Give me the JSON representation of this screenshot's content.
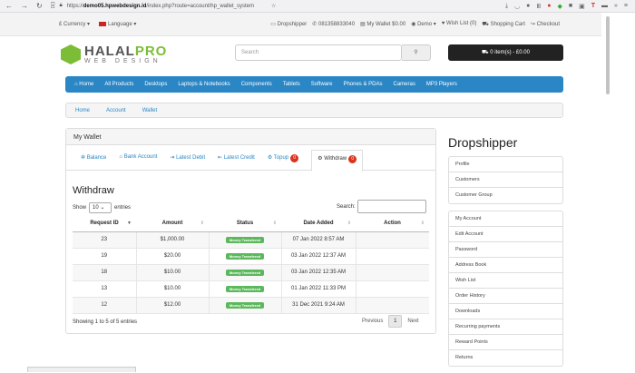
{
  "browser": {
    "url_prefix": "https://",
    "url_host": "demo05.hpwebdesign.id",
    "url_path": "/index.php?route=account/hp_wallet_system"
  },
  "topbar": {
    "currency": "£ Currency ▾",
    "language": "Language ▾",
    "dropshipper": "Dropshipper",
    "phone": "081358833040",
    "wallet": "My Wallet $0.00",
    "demo": "Demo ▾",
    "wishlist": "Wish List (0)",
    "shopping_cart": "Shopping Cart",
    "checkout": "Checkout"
  },
  "logo": {
    "halal": "HALAL",
    "pro": "PRO",
    "sub": "WEB DESIGN"
  },
  "search": {
    "placeholder": "Search"
  },
  "cart": {
    "label": "0 item(s) - £0.00"
  },
  "menu": [
    "Home",
    "All Products",
    "Desktops",
    "Laptops & Notebooks",
    "Components",
    "Tablets",
    "Software",
    "Phones & PDAs",
    "Cameras",
    "MP3 Players"
  ],
  "breadcrumb": [
    "Home",
    "Account",
    "Wallet"
  ],
  "panel": {
    "title": "My Wallet"
  },
  "tabs": [
    {
      "label": "Balance"
    },
    {
      "label": "Bank Account"
    },
    {
      "label": "Latest Debit"
    },
    {
      "label": "Latest Credit"
    },
    {
      "label": "Topup",
      "badge": "0"
    },
    {
      "label": "Withdraw",
      "badge": "0"
    }
  ],
  "withdraw": {
    "title": "Withdraw",
    "show_label": "Show",
    "entries_value": "10",
    "entries_label": "entries",
    "search_label": "Search:",
    "columns": [
      "Request ID",
      "Amount",
      "Status",
      "Date Added",
      "Action"
    ],
    "rows": [
      {
        "id": "23",
        "amount": "$1,000.00",
        "status": "Money Transfered",
        "date": "07 Jan 2022 8:57 AM",
        "action": ""
      },
      {
        "id": "19",
        "amount": "$20.00",
        "status": "Money Transfered",
        "date": "03 Jan 2022 12:37 AM",
        "action": ""
      },
      {
        "id": "18",
        "amount": "$10.00",
        "status": "Money Transfered",
        "date": "03 Jan 2022 12:35 AM",
        "action": ""
      },
      {
        "id": "13",
        "amount": "$10.00",
        "status": "Money Transfered",
        "date": "01 Jan 2022 11:33 PM",
        "action": ""
      },
      {
        "id": "12",
        "amount": "$12.00",
        "status": "Money Transfered",
        "date": "31 Dec 2021 9:24 AM",
        "action": ""
      }
    ],
    "info": "Showing 1 to 5 of 5 entries",
    "previous": "Previous",
    "page": "1",
    "next": "Next"
  },
  "sidebar": {
    "title": "Dropshipper",
    "group1": [
      "Profile",
      "Customers",
      "Customer Group"
    ],
    "group2": [
      "My Account",
      "Edit Account",
      "Password",
      "Address Book",
      "Wish List",
      "Order History",
      "Downloads",
      "Recurring payments",
      "Reward Points",
      "Returns"
    ]
  },
  "colors": {
    "menu": "#2a86c5",
    "accent": "#7cbd37",
    "status": "#5cb85c",
    "badge": "#d9341f"
  }
}
